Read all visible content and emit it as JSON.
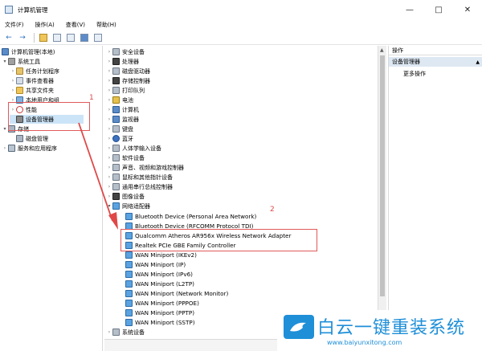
{
  "window": {
    "title": "计算机管理",
    "min_glyph": "—",
    "max_glyph": "□",
    "close_glyph": "✕"
  },
  "menu": [
    "文件(F)",
    "操作(A)",
    "查看(V)",
    "帮助(H)"
  ],
  "toolbar": {
    "back_glyph": "←",
    "forward_glyph": "→"
  },
  "tree": {
    "root": "计算机管理(本地)",
    "system_tools": "系统工具",
    "task_scheduler": "任务计划程序",
    "event_viewer": "事件查看器",
    "shared_folders": "共享文件夹",
    "local_users": "本地用户和组",
    "performance": "性能",
    "device_manager": "设备管理器",
    "storage": "存储",
    "disk_management": "磁盘管理",
    "services": "服务和应用程序"
  },
  "devices": {
    "categories": [
      "安全设备",
      "处理器",
      "磁盘驱动器",
      "存储控制器",
      "打印队列",
      "电池",
      "计算机",
      "监视器",
      "键盘",
      "蓝牙",
      "人体学输入设备",
      "软件设备",
      "声音、视频和游戏控制器",
      "鼠标和其他指针设备",
      "通用串行总线控制器",
      "图像设备",
      "网络适配器"
    ],
    "network_adapters": [
      "Bluetooth Device (Personal Area Network)",
      "Bluetooth Device (RFCOMM Protocol TDI)",
      "Qualcomm Atheros AR956x Wireless Network Adapter",
      "Realtek PCIe GBE Family Controller",
      "WAN Miniport (IKEv2)",
      "WAN Miniport (IP)",
      "WAN Miniport (IPv6)",
      "WAN Miniport (L2TP)",
      "WAN Miniport (Network Monitor)",
      "WAN Miniport (PPPOE)",
      "WAN Miniport (PPTP)",
      "WAN Miniport (SSTP)"
    ],
    "last_category": "系统设备"
  },
  "actions": {
    "header": "操作",
    "section": "设备管理器",
    "more": "更多操作"
  },
  "annotations": {
    "one": "1",
    "two": "2"
  },
  "watermark": {
    "text": "白云一键重装系统",
    "url": "www.baiyunxitong.com"
  },
  "colors": {
    "accent_blue": "#1f8fd8",
    "annotation_red": "#e15a5a",
    "selection": "#cce4f7"
  }
}
